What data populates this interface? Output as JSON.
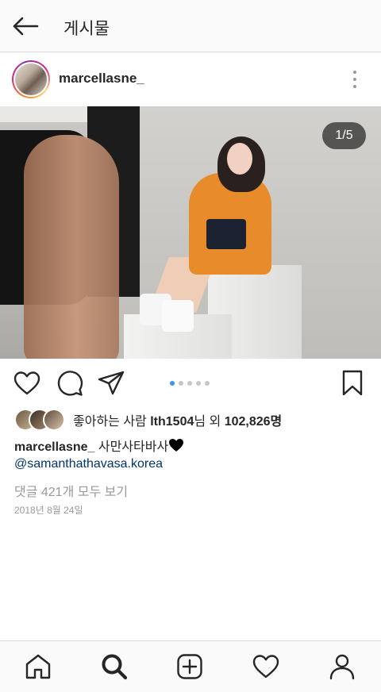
{
  "topbar": {
    "title": "게시물"
  },
  "post": {
    "username": "marcellasne_",
    "image_counter": "1/5",
    "carousel": {
      "total": 5,
      "active_index": 0
    },
    "likes": {
      "prefix": "좋아하는 사람",
      "liker": "lth1504",
      "connector": "님 외",
      "count": "102,826",
      "suffix": "명"
    },
    "caption_text": "사만사타바사",
    "mention": "@samanthathavasa.korea",
    "view_comments": "댓글 421개 모두 보기",
    "date": "2018년 8월 24일"
  },
  "icons": {
    "back": "back-arrow-icon",
    "more": "more-options-icon",
    "like": "heart-icon",
    "comment": "comment-icon",
    "share": "share-icon",
    "save": "bookmark-icon",
    "home": "home-icon",
    "search": "search-icon",
    "new_post": "add-post-icon",
    "activity": "heart-icon",
    "profile": "profile-icon"
  },
  "colors": {
    "accent": "#3897f0",
    "text": "#262626",
    "muted": "#999999",
    "link": "#003569",
    "caption_heart": "#000000"
  }
}
